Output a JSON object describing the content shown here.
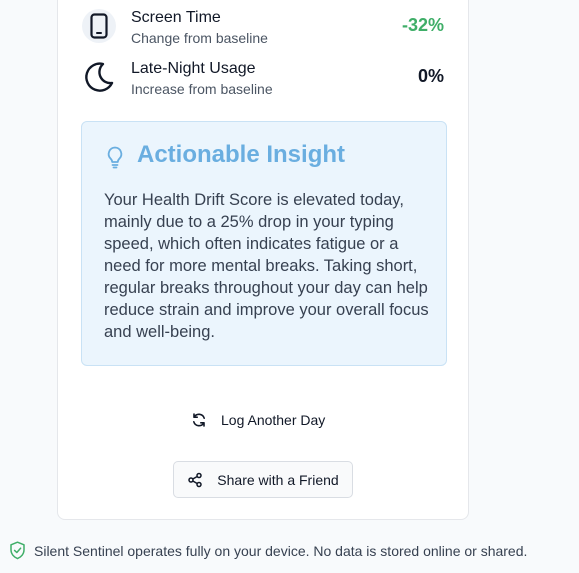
{
  "metrics": [
    {
      "title": "Screen Time",
      "subtitle": "Change from baseline",
      "value": "-32%",
      "value_color": "#3fae68",
      "icon": "phone-icon"
    },
    {
      "title": "Late-Night Usage",
      "subtitle": "Increase from baseline",
      "value": "0%",
      "value_color": "#111827",
      "icon": "moon-icon"
    }
  ],
  "insight": {
    "title": "Actionable Insight",
    "icon": "lightbulb-icon",
    "body": "Your Health Drift Score is elevated today, mainly due to a 25% drop in your typing speed, which often indicates fatigue or a need for more mental breaks. Taking short, regular breaks throughout your day can help reduce strain and improve your overall focus and well-being."
  },
  "actions": {
    "log_label": "Log Another Day",
    "share_label": "Share with a Friend"
  },
  "footer": {
    "text": "Silent Sentinel operates fully on your device. No data is stored online or shared."
  },
  "colors": {
    "accent": "#6aaee0",
    "positive": "#3fae68",
    "footer_icon": "#3fae68"
  }
}
